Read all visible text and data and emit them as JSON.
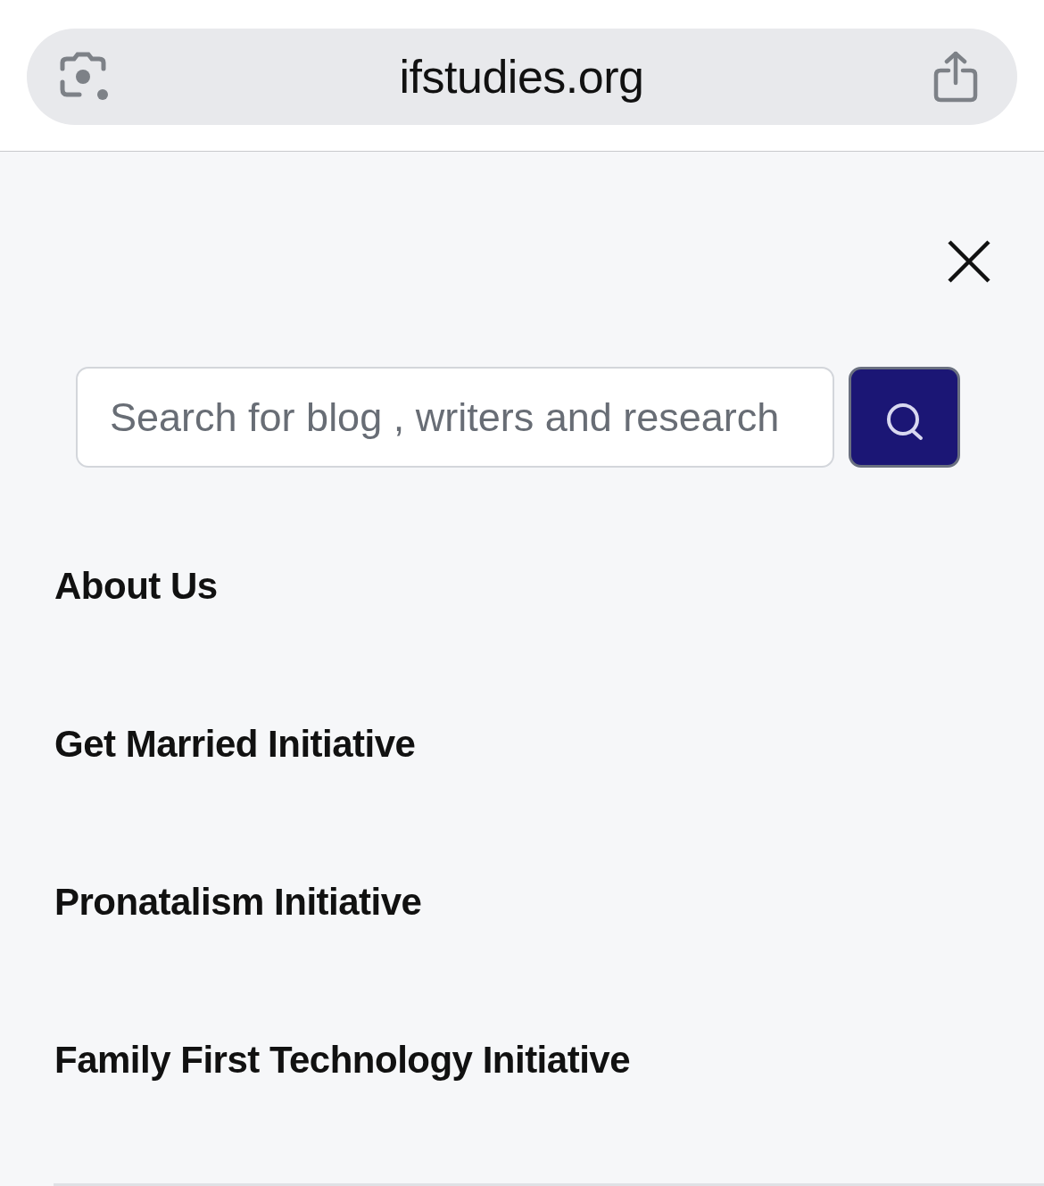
{
  "browser": {
    "url": "ifstudies.org"
  },
  "search": {
    "placeholder": "Search for blog , writers and research"
  },
  "menu": [
    {
      "label": "About Us"
    },
    {
      "label": "Get Married Initiative"
    },
    {
      "label": "Pronatalism Initiative"
    },
    {
      "label": "Family First Technology Initiative"
    }
  ]
}
